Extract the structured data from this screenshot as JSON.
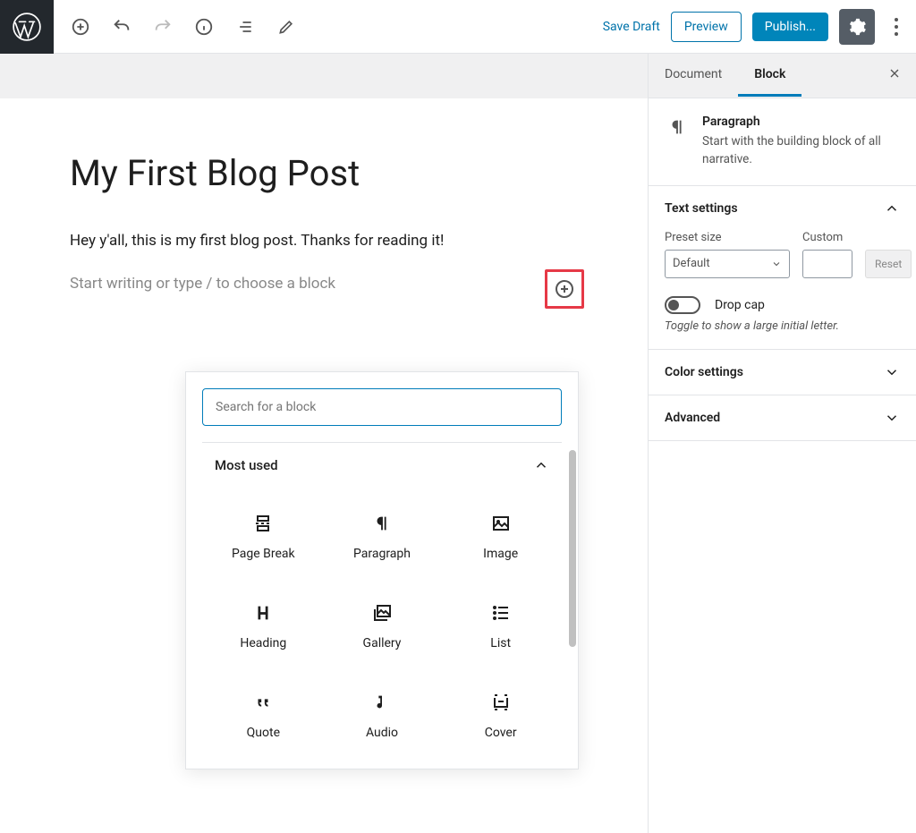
{
  "toolbar": {
    "save_draft": "Save Draft",
    "preview": "Preview",
    "publish": "Publish..."
  },
  "post": {
    "title": "My First Blog Post",
    "paragraph": "Hey y'all, this is my first blog post. Thanks for reading it!",
    "placeholder": "Start writing or type / to choose a block"
  },
  "inserter": {
    "search_placeholder": "Search for a block",
    "section_title": "Most used",
    "blocks": [
      {
        "label": "Page Break",
        "icon": "page-break"
      },
      {
        "label": "Paragraph",
        "icon": "paragraph"
      },
      {
        "label": "Image",
        "icon": "image"
      },
      {
        "label": "Heading",
        "icon": "heading"
      },
      {
        "label": "Gallery",
        "icon": "gallery"
      },
      {
        "label": "List",
        "icon": "list"
      },
      {
        "label": "Quote",
        "icon": "quote"
      },
      {
        "label": "Audio",
        "icon": "audio"
      },
      {
        "label": "Cover",
        "icon": "cover"
      }
    ]
  },
  "sidebar": {
    "tabs": {
      "document": "Document",
      "block": "Block"
    },
    "block_info": {
      "title": "Paragraph",
      "desc": "Start with the building block of all narrative."
    },
    "text_settings": {
      "title": "Text settings",
      "preset_label": "Preset size",
      "preset_value": "Default",
      "custom_label": "Custom",
      "reset_label": "Reset",
      "dropcap_label": "Drop cap",
      "dropcap_help": "Toggle to show a large initial letter."
    },
    "color_settings": {
      "title": "Color settings"
    },
    "advanced": {
      "title": "Advanced"
    }
  }
}
